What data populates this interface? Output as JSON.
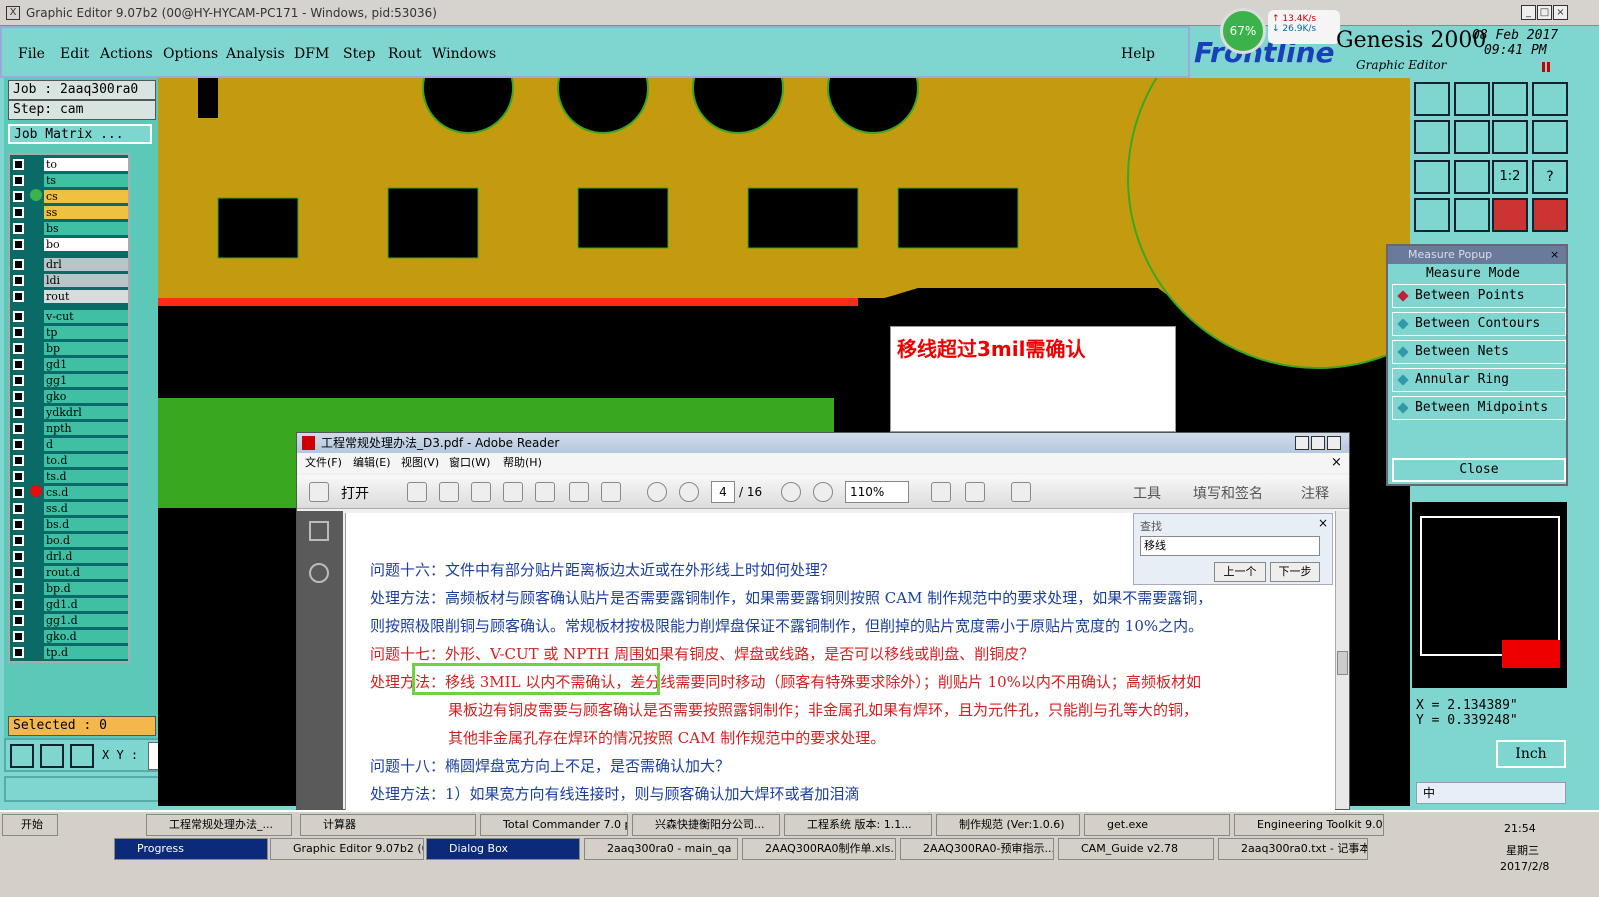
{
  "window": {
    "title": "Graphic Editor 9.07b2 (00@HY-HYCAM-PC171 - Windows, pid:53036)"
  },
  "menu": {
    "items": [
      "File",
      "Edit",
      "Actions",
      "Options",
      "Analysis",
      "DFM",
      "Step",
      "Rout",
      "Windows"
    ],
    "help": "Help"
  },
  "brand": {
    "logo_text": "Frontline",
    "product": "Genesis 2000",
    "subtitle": "Graphic Editor",
    "date": "08 Feb 2017",
    "time": "09:41 PM",
    "net_pct": "67%",
    "up": "13.4K/s",
    "down": "26.9K/s"
  },
  "job": {
    "job_line": "Job : 2aaq300ra0",
    "step_line": "Step: cam",
    "matrix_btn": "Job Matrix ...",
    "selected": "Selected : 0",
    "xy_label": "X Y :"
  },
  "layers": [
    {
      "name": "to",
      "color": "#ffffff"
    },
    {
      "name": "ts",
      "color": "#3fbfa4"
    },
    {
      "name": "cs",
      "color": "#f0c040"
    },
    {
      "name": "ss",
      "color": "#f0c040"
    },
    {
      "name": "bs",
      "color": "#3fbfa4"
    },
    {
      "name": "bo",
      "color": "#ffffff"
    },
    {
      "name": "drl",
      "color": "#b8c4c8"
    },
    {
      "name": "ldi",
      "color": "#b8c4c8"
    },
    {
      "name": "rout",
      "color": "#d8dcdc"
    },
    {
      "name": "v-cut",
      "color": "#3fbfa4"
    },
    {
      "name": "tp",
      "color": "#3fbfa4"
    },
    {
      "name": "bp",
      "color": "#3fbfa4"
    },
    {
      "name": "gd1",
      "color": "#3fbfa4"
    },
    {
      "name": "gg1",
      "color": "#3fbfa4"
    },
    {
      "name": "gko",
      "color": "#3fbfa4"
    },
    {
      "name": "ydkdrl",
      "color": "#3fbfa4"
    },
    {
      "name": "npth",
      "color": "#3fbfa4"
    },
    {
      "name": "d",
      "color": "#3fbfa4"
    },
    {
      "name": "to.d",
      "color": "#3fbfa4"
    },
    {
      "name": "ts.d",
      "color": "#3fbfa4"
    },
    {
      "name": "cs.d",
      "color": "#3fbfa4"
    },
    {
      "name": "ss.d",
      "color": "#3fbfa4"
    },
    {
      "name": "bs.d",
      "color": "#3fbfa4"
    },
    {
      "name": "bo.d",
      "color": "#3fbfa4"
    },
    {
      "name": "drl.d",
      "color": "#3fbfa4"
    },
    {
      "name": "rout.d",
      "color": "#3fbfa4"
    },
    {
      "name": "bp.d",
      "color": "#3fbfa4"
    },
    {
      "name": "gd1.d",
      "color": "#3fbfa4"
    },
    {
      "name": "gg1.d",
      "color": "#3fbfa4"
    },
    {
      "name": "gko.d",
      "color": "#3fbfa4"
    },
    {
      "name": "tp.d",
      "color": "#3fbfa4"
    }
  ],
  "note": {
    "text": "移线超过3mil需确认"
  },
  "reader": {
    "title": "工程常规处理办法_D3.pdf - Adobe Reader",
    "menu": [
      "文件(F)",
      "编辑(E)",
      "视图(V)",
      "窗口(W)",
      "帮助(H)"
    ],
    "open": "打开",
    "page_num": "4",
    "page_total": "/ 16",
    "zoom": "110%",
    "right_tools": [
      "工具",
      "填写和签名",
      "注释"
    ],
    "find_title": "查找",
    "find_value": "移线",
    "prev": "上一个",
    "next": "下一步",
    "lines": [
      "问题十六：文件中有部分贴片距离板边太近或在外形线上时如何处理？",
      "处理方法：高频板材与顾客确认贴片是否需要露铜制作，如果需要露铜则按照 CAM 制作规范中的要求处理，如果不需要露铜，",
      "则按照极限削铜与顾客确认。常规板材按极限能力削焊盘保证不露铜制作，但削掉的贴片宽度需小于原贴片宽度的 10%之内。",
      "问题十七：外形、V-CUT 或 NPTH 周围如果有铜皮、焊盘或线路，是否可以移线或削盘、削铜皮？",
      "处理方法：移线 3MIL 以内不需确认，差分线需要同时移动（顾客有特殊要求除外）；削贴片 10%以内不用确认；高频板材如",
      "果板边有铜皮需要与顾客确认是否需要按照露铜制作；非金属孔如果有焊环，且为元件孔，只能削与孔等大的铜，",
      "其他非金属孔存在焊环的情况按照 CAM 制作规范中的要求处理。",
      "问题十八：椭圆焊盘宽方向上不足，是否需确认加大？",
      "处理方法：1）如果宽方向有线连接时，则与顾客确认加大焊环或者加泪滴"
    ]
  },
  "measure": {
    "title": "Measure Popup",
    "mode": "Measure Mode",
    "items": [
      "Between Points",
      "Between Contours",
      "Between Nets",
      "Annular Ring",
      "Between Midpoints"
    ],
    "close": "Close"
  },
  "coords": {
    "x": "X = 2.134389\"",
    "y": "Y = 0.339248\"",
    "unit": "Inch"
  },
  "tool_labels": [
    "1:2",
    "?"
  ],
  "taskbar": {
    "start": "开始",
    "row1": [
      "工程常规处理办法_...",
      "计算器",
      "Total Commander 7.0 p...",
      "兴森快捷衡阳分公司...",
      "工程系统 版本: 1.1...",
      "制作规范 (Ver:1.0.6)",
      "get.exe",
      "Engineering Toolkit 9.0..."
    ],
    "row2": [
      "Progress",
      "Graphic Editor 9.07b2 (0...",
      "Dialog Box",
      "2aaq300ra0 - main_qa",
      "2AAQ300RA0制作单.xls...",
      "2AAQ300RA0-预审指示...",
      "CAM_Guide v2.78",
      "2aaq300ra0.txt - 记事本"
    ],
    "clock": "21:54",
    "weekday": "星期三",
    "date": "2017/2/8",
    "ime": "中"
  }
}
